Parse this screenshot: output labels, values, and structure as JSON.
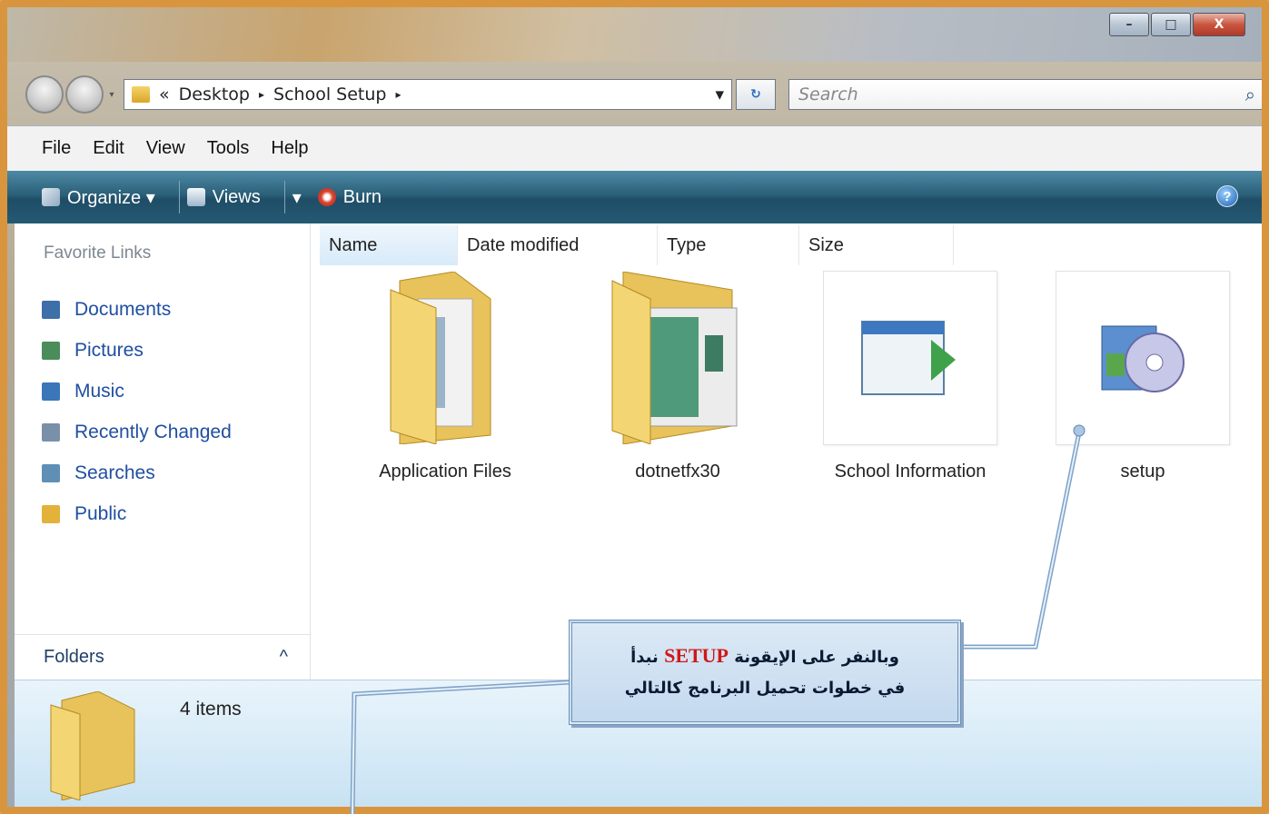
{
  "window": {
    "controls": {
      "minimize": "–",
      "maximize": "□",
      "close": "X"
    }
  },
  "address": {
    "chevron": "«",
    "crumbs": [
      "Desktop",
      "School Setup"
    ],
    "separator": "▸",
    "dropdown": "▾",
    "refresh_icon": "↻"
  },
  "search": {
    "placeholder": "Search",
    "icon": "search-icon"
  },
  "menu": [
    "File",
    "Edit",
    "View",
    "Tools",
    "Help"
  ],
  "toolbar": {
    "organize": "Organize ▾",
    "views": "Views",
    "views_dropdown": "▾",
    "burn": "Burn",
    "help": "?"
  },
  "sidebar": {
    "favorites_title": "Favorite Links",
    "links": [
      {
        "label": "Documents",
        "icon": "documents-icon",
        "color": "#3d6fa8"
      },
      {
        "label": "Pictures",
        "icon": "pictures-icon",
        "color": "#4a8c5a"
      },
      {
        "label": "Music",
        "icon": "music-icon",
        "color": "#3b76b8"
      },
      {
        "label": "Recently Changed",
        "icon": "recently-changed-icon",
        "color": "#7a8fa8"
      },
      {
        "label": "Searches",
        "icon": "searches-icon",
        "color": "#5f8fb5"
      },
      {
        "label": "Public",
        "icon": "public-folder-icon",
        "color": "#e2b23a"
      }
    ],
    "folders_label": "Folders",
    "folders_toggle": "^"
  },
  "columns": [
    "Name",
    "Date modified",
    "Type",
    "Size"
  ],
  "files": [
    {
      "name": "Application Files",
      "icon": "folder-icon"
    },
    {
      "name": "dotnetfx30",
      "icon": "folder-icon"
    },
    {
      "name": "School Information",
      "icon": "application-icon"
    },
    {
      "name": "setup",
      "icon": "setup-icon"
    }
  ],
  "status": {
    "count": "4 items"
  },
  "callout": {
    "line1_prefix": "وبالنفر على الإيقونة",
    "line1_highlight": "SETUP",
    "line1_suffix": "نبدأ",
    "line2": "في خطوات تحميل البرنامج كالتالي"
  }
}
